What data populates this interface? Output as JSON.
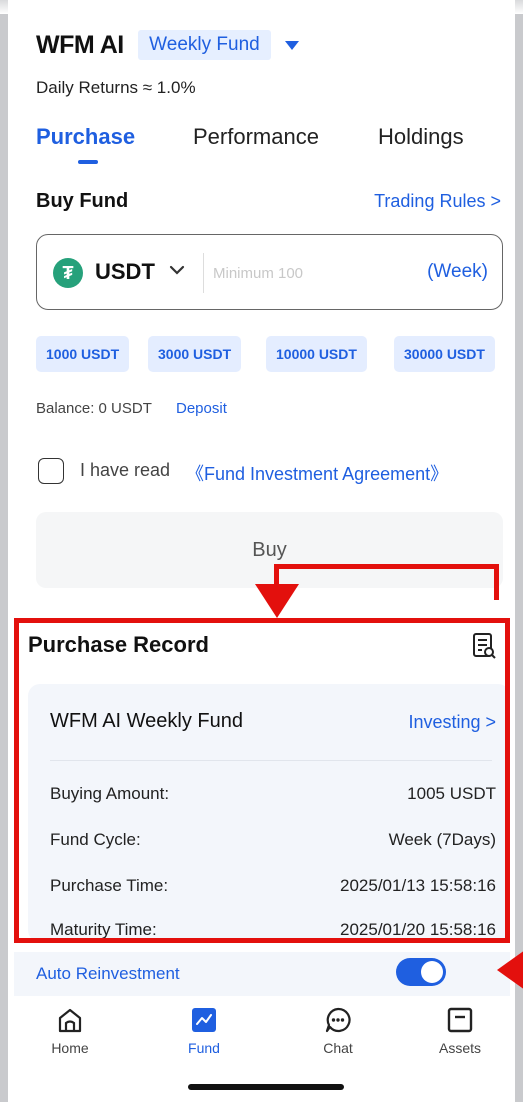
{
  "header": {
    "fund_name": "WFM AI",
    "fund_tag": "Weekly Fund",
    "daily_returns": "Daily Returns ≈ 1.0%"
  },
  "tabs": [
    {
      "label": "Purchase",
      "active": true
    },
    {
      "label": "Performance",
      "active": false
    },
    {
      "label": "Holdings",
      "active": false
    }
  ],
  "buy": {
    "title": "Buy Fund",
    "rules_link": "Trading Rules >",
    "coin": "USDT",
    "coin_symbol": "₮",
    "placeholder": "Minimum 100",
    "unit": "(Week)",
    "chips": [
      "1000 USDT",
      "3000 USDT",
      "10000 USDT",
      "30000 USDT"
    ],
    "balance": "Balance: 0 USDT",
    "deposit": "Deposit",
    "agree_text": "I have read",
    "agree_link": "《Fund Investment Agreement》",
    "button": "Buy"
  },
  "record": {
    "title": "Purchase Record",
    "card_title": "WFM AI Weekly Fund",
    "status": "Investing >",
    "rows": [
      {
        "label": "Buying Amount:",
        "value": "1005 USDT"
      },
      {
        "label": "Fund Cycle:",
        "value": "Week (7Days)"
      },
      {
        "label": "Purchase Time:",
        "value": "2025/01/13 15:58:16"
      },
      {
        "label": "Maturity Time:",
        "value": "2025/01/20 15:58:16"
      }
    ],
    "auto_reinvest": "Auto Reinvestment",
    "auto_reinvest_on": true
  },
  "nav": [
    {
      "label": "Home",
      "icon": "home-icon",
      "active": false
    },
    {
      "label": "Fund",
      "icon": "fund-chart-icon",
      "active": true
    },
    {
      "label": "Chat",
      "icon": "chat-icon",
      "active": false
    },
    {
      "label": "Assets",
      "icon": "assets-icon",
      "active": false
    }
  ],
  "colors": {
    "accent": "#1f5fe0",
    "annotation": "#e3100d",
    "usdt": "#26a17b"
  }
}
